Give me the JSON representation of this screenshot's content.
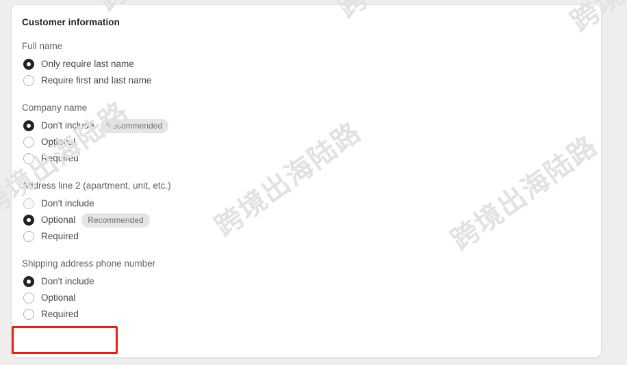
{
  "card": {
    "title": "Customer information",
    "groups": [
      {
        "label": "Full name",
        "options": [
          {
            "label": "Only require last name",
            "selected": true,
            "badge": null,
            "dim": false
          },
          {
            "label": "Require first and last name",
            "selected": false,
            "badge": null,
            "dim": false
          }
        ]
      },
      {
        "label": "Company name",
        "options": [
          {
            "label": "Don't include",
            "selected": true,
            "badge": "Recommended",
            "dim": false
          },
          {
            "label": "Optional",
            "selected": false,
            "badge": null,
            "dim": false
          },
          {
            "label": "Required",
            "selected": false,
            "badge": null,
            "dim": false
          }
        ]
      },
      {
        "label": "Address line 2 (apartment, unit, etc.)",
        "options": [
          {
            "label": "Don't include",
            "selected": false,
            "badge": null,
            "dim": true
          },
          {
            "label": "Optional",
            "selected": true,
            "badge": "Recommended",
            "dim": false
          },
          {
            "label": "Required",
            "selected": false,
            "badge": null,
            "dim": false
          }
        ]
      },
      {
        "label": "Shipping address phone number",
        "options": [
          {
            "label": "Don't include",
            "selected": true,
            "badge": null,
            "dim": false
          },
          {
            "label": "Optional",
            "selected": false,
            "badge": null,
            "dim": false
          },
          {
            "label": "Required",
            "selected": false,
            "badge": null,
            "dim": false
          }
        ]
      }
    ]
  },
  "annotation": {
    "color": "#f01b0d",
    "target_label": "Required"
  },
  "watermark": {
    "text": "跨境出海陆路",
    "color": "#e2e2e2"
  },
  "colors": {
    "page_background": "#eeeeee",
    "card_background": "#ffffff",
    "title_text": "#202223",
    "group_label_text": "#5c5f62",
    "option_text": "#42474b",
    "badge_background": "#e4e5e7",
    "badge_text": "#6d7175",
    "radio_selected": "#1f2326",
    "radio_unselected_border": "#aeb4b9"
  }
}
